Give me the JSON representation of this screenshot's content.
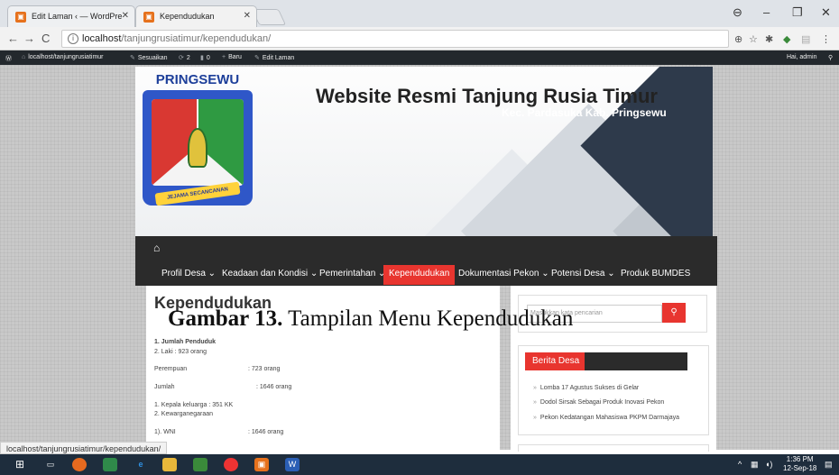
{
  "browser": {
    "tabs": [
      {
        "label": "Edit Laman ‹ — WordPre",
        "active": false
      },
      {
        "label": "Kependudukan",
        "active": true
      }
    ],
    "url_host": "localhost",
    "url_path": "/tanjungrusiatimur/kependudukan/",
    "status_url": "localhost/tanjungrusiatimur/kependudukan/"
  },
  "adminbar": {
    "site": "localhost/tanjungrusiatimur",
    "customize": "Sesuaikan",
    "updates": "2",
    "comments": "0",
    "new": "Baru",
    "edit": "Edit Laman",
    "greeting": "Hai, admin"
  },
  "header": {
    "logo_text": "PRINGSEWU",
    "logo_ribbon": "JEJAMA SECANCANAN",
    "title": "Website Resmi Tanjung Rusia Timur",
    "subtitle": "Kec. Pardasuka Kab. Pringsewu"
  },
  "nav": {
    "items": [
      {
        "label": "Profil Desa ⌄"
      },
      {
        "label": "Keadaan dan Kondisi ⌄"
      },
      {
        "label": "Pemerintahan ⌄"
      },
      {
        "label": "Kependudukan"
      },
      {
        "label": "Dokumentasi Pekon ⌄"
      },
      {
        "label": "Potensi Desa ⌄"
      },
      {
        "label": "Produk BUMDES"
      }
    ]
  },
  "content": {
    "title": "Kependudukan",
    "caption_bold": "Gambar 13.",
    "caption_rest": " Tampilan Menu Kependudukan",
    "lines": [
      "1. Jumlah Penduduk",
      "2. Laki : 923   orang",
      "Perempuan",
      ": 723   orang",
      "Jumlah",
      ": 1646 orang",
      "1. Kepala keluarga :  351  KK",
      "2. Kewarganegaraan",
      "1). WNI",
      ": 1646 orang"
    ]
  },
  "sidebar": {
    "search_placeholder": "Masukkan kata pencarian",
    "news_title": "Berita Desa",
    "news": [
      "Lomba 17 Agustus Sukses di Gelar",
      "Dodol Sirsak Sebagai Produk Inovasi Pekon",
      "Pekon Kedatangan Mahasiswa PKPM Darmajaya"
    ]
  },
  "taskbar": {
    "time": "1:36 PM",
    "date": "12-Sep-18"
  }
}
